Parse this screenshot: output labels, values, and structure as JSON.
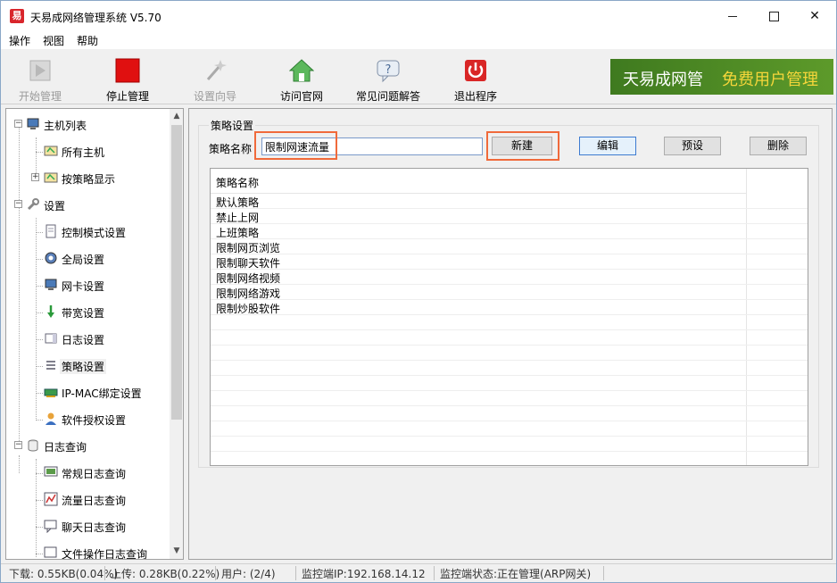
{
  "window": {
    "title": "天易成网络管理系统 V5.70",
    "icon_char": "易"
  },
  "menu": [
    "操作",
    "视图",
    "帮助"
  ],
  "toolbar": {
    "start": "开始管理",
    "stop": "停止管理",
    "wizard": "设置向导",
    "website": "访问官网",
    "faq": "常见问题解答",
    "exit": "退出程序"
  },
  "banner": {
    "brand": "天易成网管",
    "slogan": "免费用户管理"
  },
  "tree": {
    "host_list": "主机列表",
    "all_hosts": "所有主机",
    "by_policy": "按策略显示",
    "settings": "设置",
    "control_mode": "控制模式设置",
    "global": "全局设置",
    "nic": "网卡设置",
    "bandwidth": "带宽设置",
    "log_settings": "日志设置",
    "policy_settings": "策略设置",
    "ipmac": "IP-MAC绑定设置",
    "license": "软件授权设置",
    "log_query": "日志查询",
    "regular_log": "常规日志查询",
    "traffic_log": "流量日志查询",
    "chat_log": "聊天日志查询",
    "file_log": "文件操作日志查询"
  },
  "policy": {
    "group_title": "策略设置",
    "name_label": "策略名称",
    "name_value": "限制网速流量",
    "btn_new": "新建",
    "btn_edit": "编辑",
    "btn_preset": "预设",
    "btn_delete": "删除",
    "list_header": "策略名称",
    "rows": [
      "默认策略",
      "禁止上网",
      "上班策略",
      "限制网页浏览",
      "限制聊天软件",
      "限制网络视频",
      "限制网络游戏",
      "限制炒股软件"
    ]
  },
  "status": {
    "download": "下载: 0.55KB(0.04%)",
    "upload": "上传: 0.28KB(0.22%)",
    "users": "用户: (2/4)",
    "monitor_ip": "监控端IP:192.168.14.12",
    "monitor_state": "监控端状态:正在管理(ARP网关)"
  },
  "colors": {
    "highlight": "#f06a3b",
    "banner_bg": "#4a8a24",
    "banner_slogan": "#f5d63a"
  }
}
